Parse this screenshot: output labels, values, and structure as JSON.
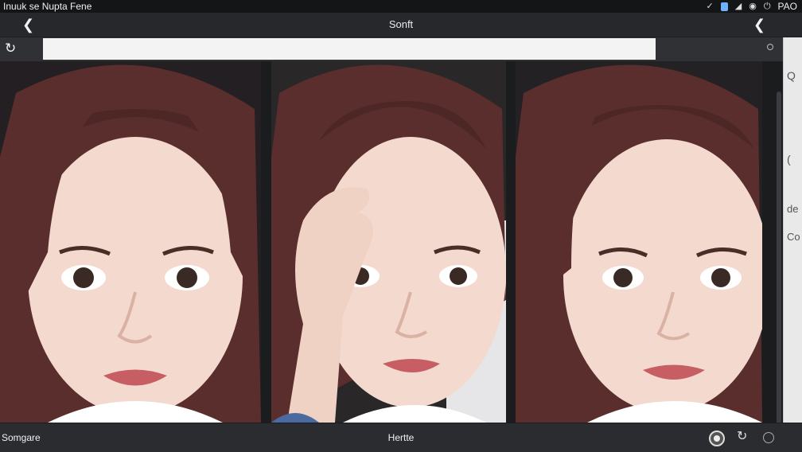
{
  "statusbar": {
    "left_text": "Inuuk se Nupta  Fene",
    "right_text": "PAO",
    "icons": [
      "check-icon",
      "battery-icon",
      "signal-icon",
      "wifi-icon",
      "power-icon"
    ]
  },
  "titlebar": {
    "title": "Sonft",
    "back_icon": "chevron-left-icon",
    "forward_icon": "chevron-left-icon"
  },
  "search": {
    "value": "",
    "placeholder": ""
  },
  "side_panel": {
    "letters": [
      "Q",
      "(",
      "de",
      "Co"
    ]
  },
  "bottombar": {
    "left_label": "Somgare",
    "center_label": "Hertte"
  },
  "photos": [
    {
      "label": "portrait-1"
    },
    {
      "label": "portrait-2"
    },
    {
      "label": "portrait-3"
    }
  ],
  "colors": {
    "background": "#2b2d30",
    "statusbar": "#141516",
    "search_field": "#f3f3f3",
    "hair": "#5a2e2c",
    "skin": "#f3d9ce"
  }
}
